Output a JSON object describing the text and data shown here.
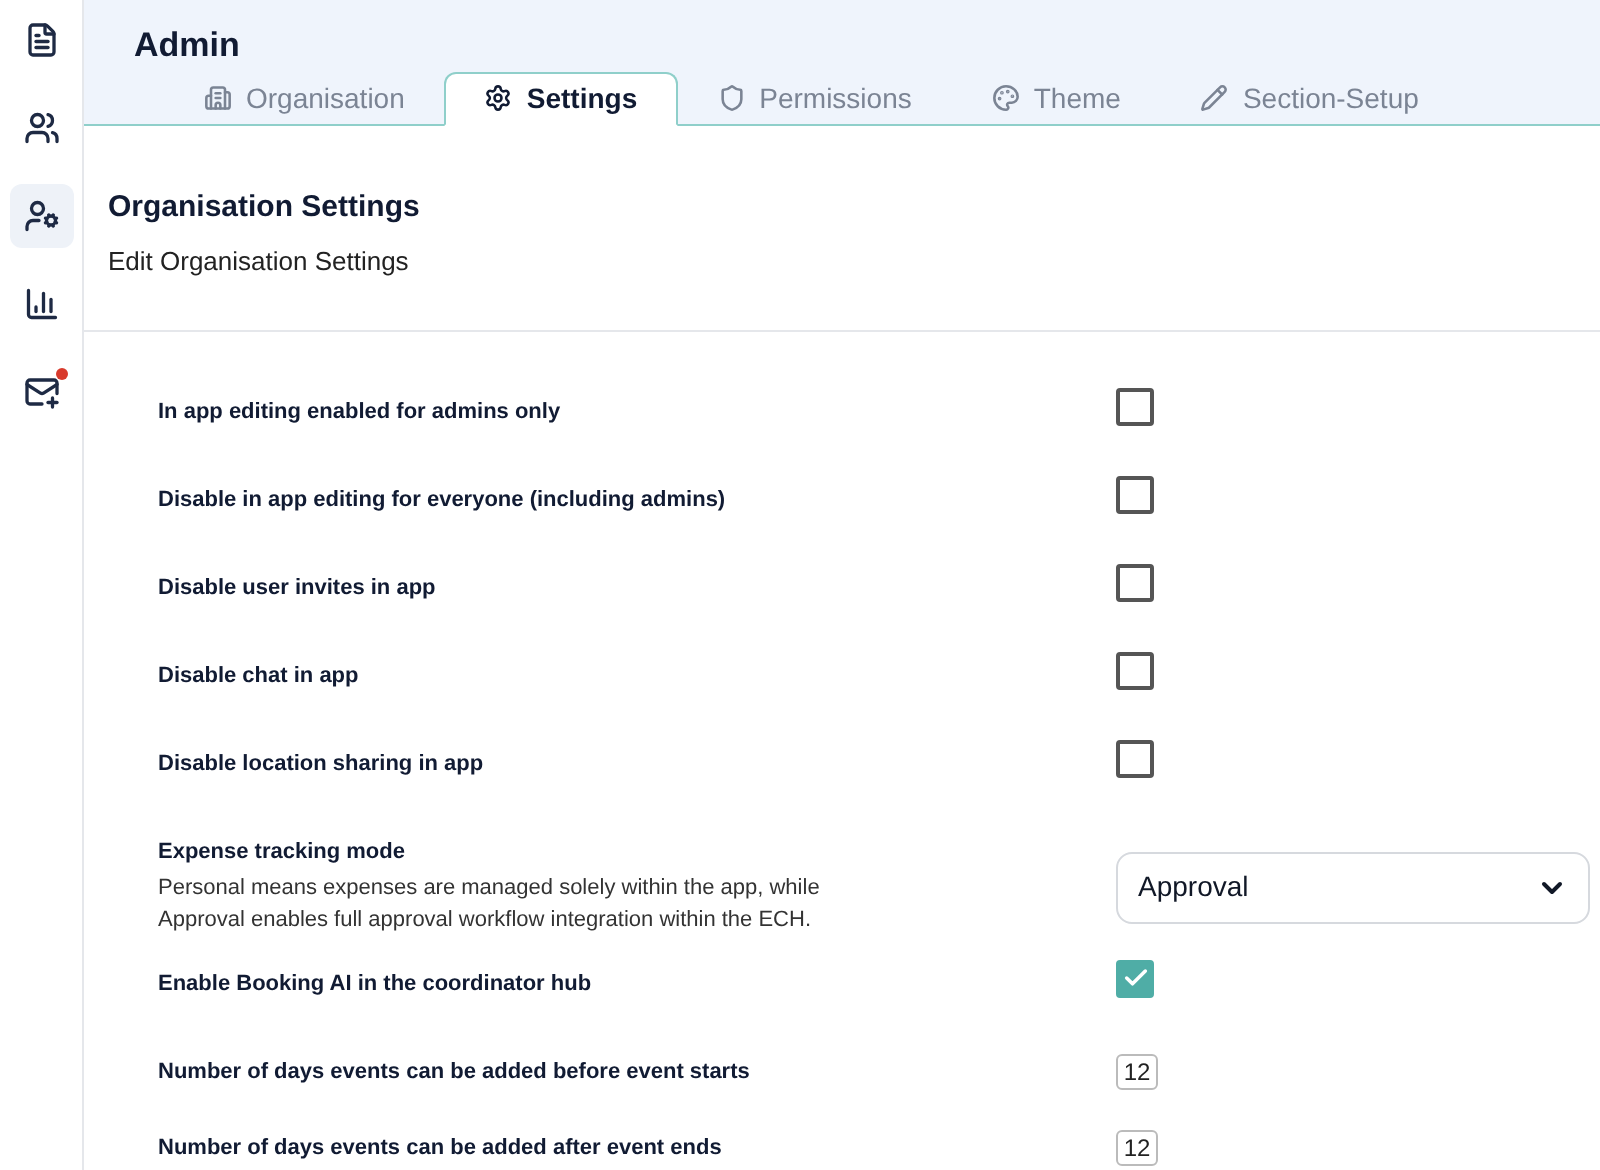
{
  "sidebar": {
    "items": [
      {
        "selected": false,
        "notification": false
      },
      {
        "selected": false,
        "notification": false
      },
      {
        "selected": true,
        "notification": false
      },
      {
        "selected": false,
        "notification": false
      },
      {
        "selected": false,
        "notification": true
      }
    ]
  },
  "header": {
    "title": "Admin"
  },
  "tabs": [
    {
      "label": "Organisation",
      "selected": false
    },
    {
      "label": "Settings",
      "selected": true
    },
    {
      "label": "Permissions",
      "selected": false
    },
    {
      "label": "Theme",
      "selected": false
    },
    {
      "label": "Section-Setup",
      "selected": false
    }
  ],
  "section": {
    "title": "Organisation Settings",
    "subtitle": "Edit Organisation Settings"
  },
  "settings": [
    {
      "kind": "checkbox",
      "label": "In app editing enabled for admins only",
      "checked": false
    },
    {
      "kind": "checkbox",
      "label": "Disable in app editing for everyone (including admins)",
      "checked": false
    },
    {
      "kind": "checkbox",
      "label": "Disable user invites in app",
      "checked": false
    },
    {
      "kind": "checkbox",
      "label": "Disable chat in app",
      "checked": false
    },
    {
      "kind": "checkbox",
      "label": "Disable location sharing in app",
      "checked": false
    },
    {
      "kind": "select",
      "label": "Expense tracking mode",
      "description": "Personal means expenses are managed solely within the app, while Approval enables full approval workflow integration within the ECH.",
      "value": "Approval"
    },
    {
      "kind": "checkbox",
      "label": "Enable Booking AI in the coordinator hub",
      "checked": true
    },
    {
      "kind": "number",
      "label": "Number of days events can be added before event starts",
      "value": "12"
    },
    {
      "kind": "number",
      "label": "Number of days events can be added after event ends",
      "value": "12"
    }
  ]
}
